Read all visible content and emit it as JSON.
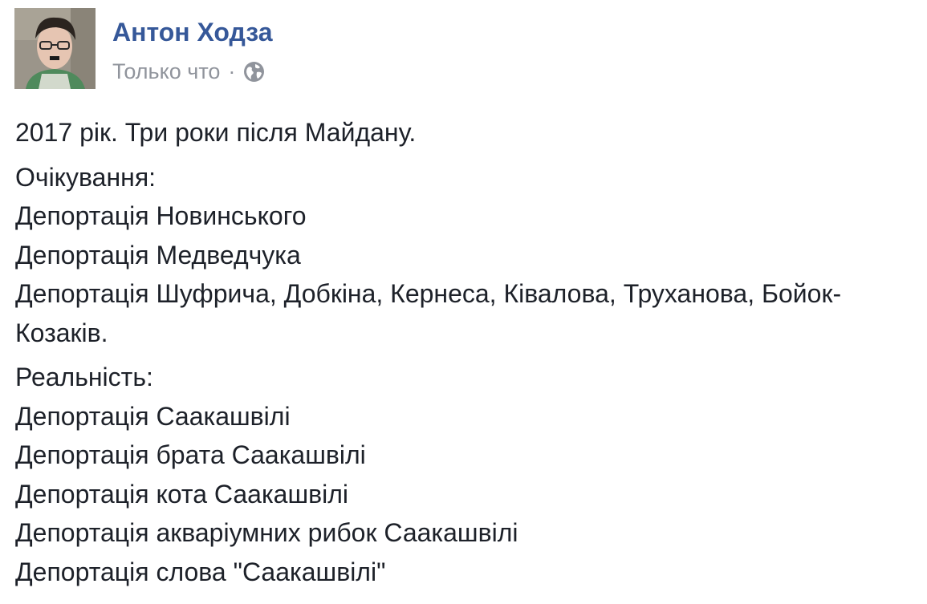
{
  "post": {
    "author": "Антон Ходза",
    "timestamp": "Только что",
    "separator": "·",
    "privacy_icon": "globe-icon",
    "colors": {
      "author": "#365899",
      "meta": "#90949c",
      "text": "#1d2129"
    },
    "intro": "2017 рік. Три роки після Майдану.",
    "expectation": {
      "heading": "Очікування:",
      "lines": [
        "Депортація Новинського",
        "Депортація Медведчука",
        "Депортація Шуфрича, Добкіна, Кернеса, Ківалова, Труханова, Бойок-",
        "Козаків."
      ]
    },
    "reality": {
      "heading": "Реальність:",
      "lines": [
        "Депортація Саакашвілі",
        "Депортація брата Саакашвілі",
        "Депортація кота Саакашвілі",
        "Депортація акваріумних рибок Саакашвілі",
        "Депортація слова \"Саакашвілі\""
      ]
    }
  }
}
